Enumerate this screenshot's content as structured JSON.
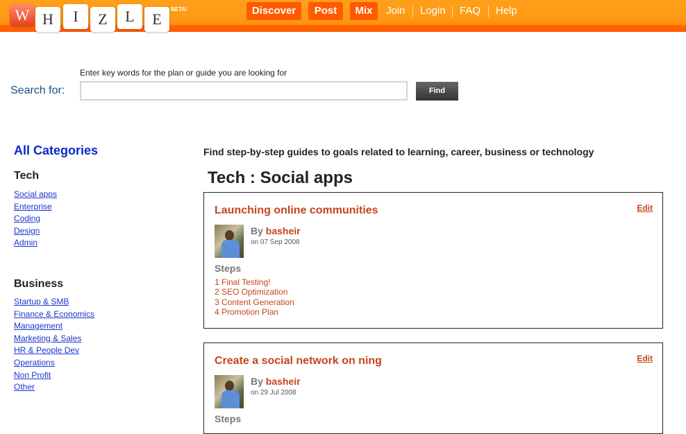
{
  "header": {
    "logo_letters": [
      "W",
      "H",
      "I",
      "Z",
      "L",
      "E"
    ],
    "beta": "BETA!",
    "nav_pills": [
      "Discover",
      "Post",
      "Mix"
    ],
    "nav_links": [
      "Join",
      "Login",
      "FAQ",
      "Help"
    ]
  },
  "search": {
    "hint": "Enter key words for the plan or guide you are looking for",
    "label": "Search for:",
    "value": "",
    "button": "Find"
  },
  "sidebar": {
    "all_categories": "All Categories",
    "groups": [
      {
        "title": "Tech",
        "items": [
          "Social apps",
          "Enterprise",
          "Coding",
          "Design",
          "Admin"
        ]
      },
      {
        "title": "Business",
        "items": [
          "Startup & SMB",
          "Finance & Economics",
          "Management",
          "Marketing & Sales",
          "HR & People Dev",
          "Operations",
          "Non Profit",
          "Other"
        ]
      }
    ]
  },
  "main": {
    "tagline": "Find step-by-step guides to goals related to learning, career, business or technology",
    "section_title": "Tech : Social apps",
    "cards": [
      {
        "title": "Launching online communities",
        "edit": "Edit",
        "by": "By",
        "author": "basheir",
        "date": "on 07 Sep 2008",
        "steps_heading": "Steps",
        "steps": [
          "1 Final Testing!",
          "2 SEO Optimization",
          "3 Content Generation",
          "4 Promotion Plan"
        ]
      },
      {
        "title": "Create a social network on ning",
        "edit": "Edit",
        "by": "By",
        "author": "basheir",
        "date": "on 29 Jul 2008",
        "steps_heading": "Steps",
        "steps": []
      }
    ]
  },
  "colors": {
    "brand_orange": "#ff9a16",
    "nav_pill": "#ff5a00",
    "link_blue": "#1a36cc",
    "guide_red": "#c4441c"
  }
}
